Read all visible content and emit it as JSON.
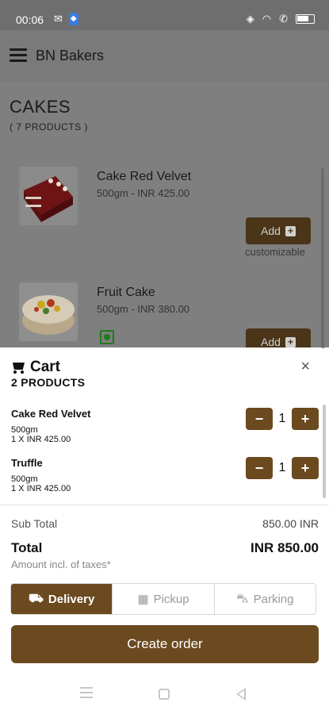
{
  "status_bar": {
    "time": "00:06",
    "left_icons": [
      "mail-icon",
      "shield-icon"
    ],
    "right_icons": [
      "eye-icon",
      "wifi-icon",
      "call-icon",
      "battery-icon"
    ]
  },
  "app_bar": {
    "title": "BN Bakers"
  },
  "category": {
    "title": "CAKES",
    "count": "( 7 PRODUCTS )"
  },
  "products": [
    {
      "name": "Cake Red Velvet",
      "price": "500gm - INR 425.00",
      "add_label": "Add",
      "note": "customizable"
    },
    {
      "name": "Fruit Cake",
      "price": "500gm - INR 380.00",
      "add_label": "Add"
    }
  ],
  "cart": {
    "title": "Cart",
    "count": "2 PRODUCTS",
    "items": [
      {
        "name": "Cake Red Velvet",
        "weight": "500gm",
        "qty_price": "1 X INR 425.00",
        "quantity": "1"
      },
      {
        "name": "Truffle",
        "weight": "500gm",
        "qty_price": "1 X INR 425.00",
        "quantity": "1"
      }
    ],
    "subtotal_label": "Sub Total",
    "subtotal_value": "850.00 INR",
    "total_label": "Total",
    "total_value": "INR 850.00",
    "tax_note": "Amount incl. of taxes*",
    "modes": [
      {
        "label": "Delivery",
        "icon": "truck-icon",
        "active": true
      },
      {
        "label": "Pickup",
        "icon": "store-icon",
        "active": false
      },
      {
        "label": "Parking",
        "icon": "car-icon",
        "active": false
      }
    ],
    "create_label": "Create order"
  },
  "colors": {
    "brand": "#6b4a20",
    "overlay": "#7f7f7f",
    "veg": "#1e7a1e"
  }
}
